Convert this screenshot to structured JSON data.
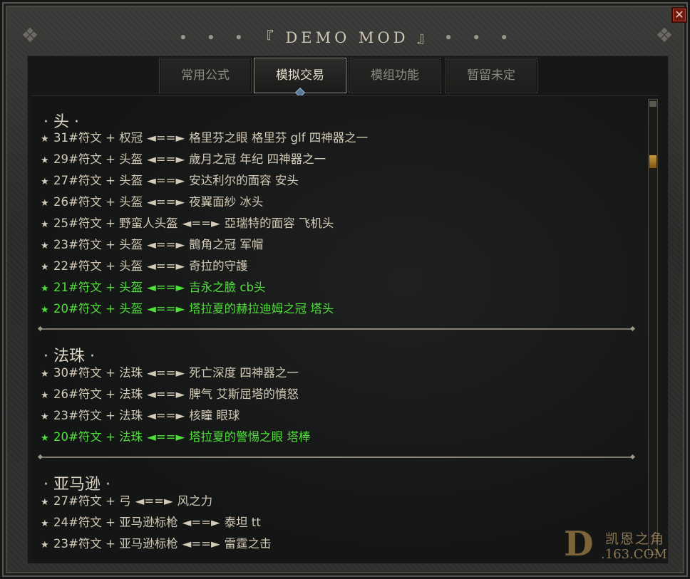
{
  "window": {
    "title_dots_left": "• • •",
    "title": "『 DEMO MOD 』",
    "title_dots_right": "• • •",
    "close_label": "✕"
  },
  "tabs": [
    {
      "label": "常用公式"
    },
    {
      "label": "模拟交易"
    },
    {
      "label": "模组功能"
    },
    {
      "label": "暂留未定"
    }
  ],
  "active_tab": "模拟交易",
  "sections": [
    {
      "title": "· 头 ·",
      "rows": [
        {
          "text": "31#符文 + 权冠",
          "arrow": "◄==►",
          "result": "格里芬之眼 格里芬 glf 四神器之一",
          "green": false
        },
        {
          "text": "29#符文 + 头盔",
          "arrow": "◄==►",
          "result": "歲月之冠 年纪 四神器之一",
          "green": false
        },
        {
          "text": "27#符文 + 头盔",
          "arrow": "◄==►",
          "result": "安达利尔的面容 安头",
          "green": false
        },
        {
          "text": "26#符文 + 头盔",
          "arrow": "◄==►",
          "result": "夜翼面紗 冰头",
          "green": false
        },
        {
          "text": "25#符文 + 野蛮人头盔",
          "arrow": "◄==►",
          "result": "亞瑞特的面容 飞机头",
          "green": false
        },
        {
          "text": "23#符文 + 头盔",
          "arrow": "◄==►",
          "result": "鵲角之冠 军帽",
          "green": false
        },
        {
          "text": "22#符文 + 头盔",
          "arrow": "◄==►",
          "result": "奇拉的守護",
          "green": false
        },
        {
          "text": "21#符文 + 头盔",
          "arrow": "◄==►",
          "result": "吉永之臉 cb头",
          "green": true
        },
        {
          "text": "20#符文 + 头盔",
          "arrow": "◄==►",
          "result": "塔拉夏的赫拉迪姆之冠 塔头",
          "green": true
        }
      ]
    },
    {
      "title": "· 法珠 ·",
      "rows": [
        {
          "text": "30#符文 + 法珠",
          "arrow": "◄==►",
          "result": "死亡深度 四神器之一",
          "green": false
        },
        {
          "text": "26#符文 + 法珠",
          "arrow": "◄==►",
          "result": "脾气 艾斯屈塔的憤怒",
          "green": false
        },
        {
          "text": "23#符文 + 法珠",
          "arrow": "◄==►",
          "result": "核瞳 眼球",
          "green": false
        },
        {
          "text": "20#符文 + 法珠",
          "arrow": "◄==►",
          "result": "塔拉夏的警惕之眼 塔棒",
          "green": true
        }
      ]
    },
    {
      "title": "· 亚马逊 ·",
      "rows": [
        {
          "text": "27#符文 + 弓",
          "arrow": "◄==►",
          "result": "风之力",
          "green": false
        },
        {
          "text": "24#符文 + 亚马逊标枪",
          "arrow": "◄==►",
          "result": "泰坦 tt",
          "green": false
        },
        {
          "text": "23#符文 + 亚马逊标枪",
          "arrow": "◄==►",
          "result": "雷霆之击",
          "green": false
        }
      ]
    }
  ],
  "star": "★",
  "watermark": {
    "logo": "D",
    "cn": "凯恩之角",
    "en": ".163.COM"
  },
  "colors": {
    "normal_text": "#d3cbb7",
    "highlight_text": "#4fe03a",
    "scroll_thumb": "#c99a3c"
  }
}
